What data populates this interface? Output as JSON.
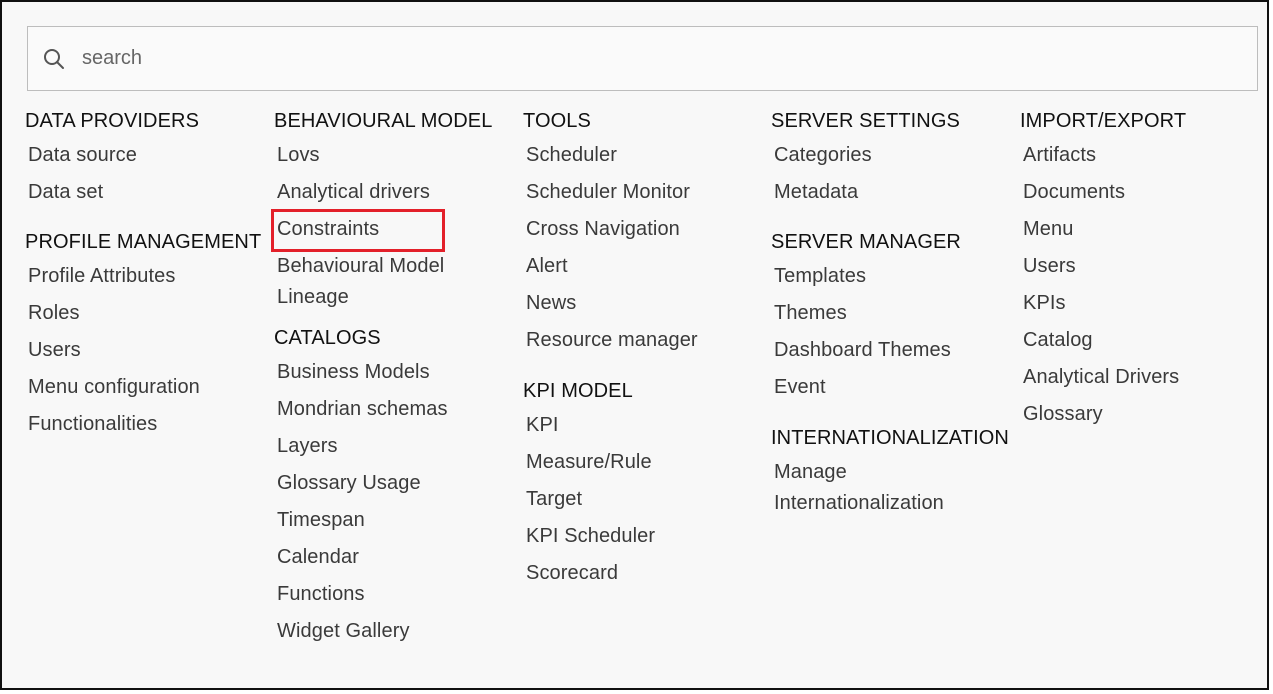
{
  "search": {
    "placeholder": "search"
  },
  "colors": {
    "highlight": "#e3202a"
  },
  "columns": [
    {
      "groups": [
        {
          "title": "DATA PROVIDERS",
          "items": [
            "Data source",
            "Data set"
          ]
        },
        {
          "title": "PROFILE MANAGEMENT",
          "items": [
            "Profile Attributes",
            "Roles",
            "Users",
            "Menu configuration",
            "Functionalities"
          ]
        }
      ]
    },
    {
      "groups": [
        {
          "title": "BEHAVIOURAL MODEL",
          "items": [
            "Lovs",
            "Analytical drivers",
            "Constraints",
            "Behavioural Model Lineage"
          ]
        },
        {
          "title": "CATALOGS",
          "items": [
            "Business Models",
            "Mondrian schemas",
            "Layers",
            "Glossary Usage",
            "Timespan",
            "Calendar",
            "Functions",
            "Widget Gallery"
          ]
        }
      ]
    },
    {
      "groups": [
        {
          "title": "TOOLS",
          "items": [
            "Scheduler",
            "Scheduler Monitor",
            "Cross Navigation",
            "Alert",
            "News",
            "Resource manager"
          ]
        },
        {
          "title": "KPI MODEL",
          "items": [
            "KPI",
            "Measure/Rule",
            "Target",
            "KPI Scheduler",
            "Scorecard"
          ]
        }
      ]
    },
    {
      "groups": [
        {
          "title": "SERVER SETTINGS",
          "items": [
            "Categories",
            "Metadata"
          ]
        },
        {
          "title": "SERVER MANAGER",
          "items": [
            "Templates",
            "Themes",
            "Dashboard Themes",
            "Event"
          ]
        },
        {
          "title": "INTERNATIONALIZATION",
          "items": [
            "Manage Internationalization"
          ]
        }
      ]
    },
    {
      "groups": [
        {
          "title": "IMPORT/EXPORT",
          "items": [
            "Artifacts",
            "Documents",
            "Menu",
            "Users",
            "KPIs",
            "Catalog",
            "Analytical Drivers",
            "Glossary"
          ]
        }
      ]
    }
  ]
}
